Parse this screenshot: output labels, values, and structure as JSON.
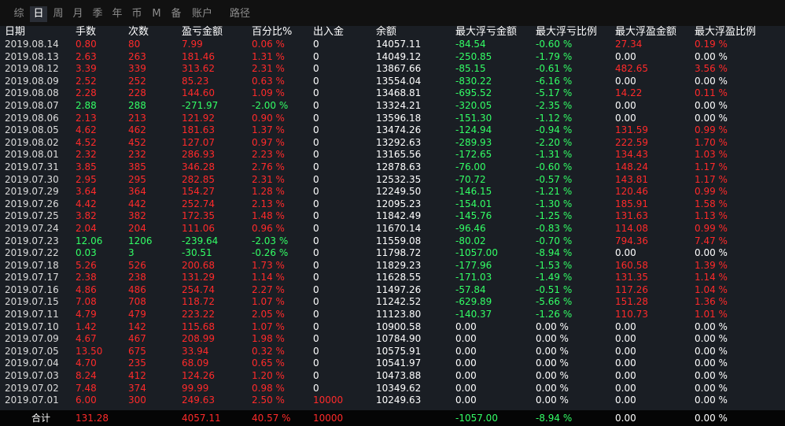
{
  "tabs": [
    "综",
    "日",
    "周",
    "月",
    "季",
    "年",
    "币",
    "M",
    "备",
    "账户",
    "路径"
  ],
  "active_tab": "日",
  "columns": [
    "日期",
    "手数",
    "次数",
    "盈亏金额",
    "百分比%",
    "出入金",
    "余额",
    "最大浮亏金额",
    "最大浮亏比例",
    "最大浮盈金额",
    "最大浮盈比例"
  ],
  "rows": [
    [
      "2019.08.14",
      "0.80",
      "80",
      "7.99",
      "0.06 %",
      "0",
      "14057.11",
      "-84.54",
      "-0.60 %",
      "27.34",
      "0.19 %"
    ],
    [
      "2019.08.13",
      "2.63",
      "263",
      "181.46",
      "1.31 %",
      "0",
      "14049.12",
      "-250.85",
      "-1.79 %",
      "0.00",
      "0.00 %"
    ],
    [
      "2019.08.12",
      "3.39",
      "339",
      "313.62",
      "2.31 %",
      "0",
      "13867.66",
      "-85.15",
      "-0.61 %",
      "482.65",
      "3.56 %"
    ],
    [
      "2019.08.09",
      "2.52",
      "252",
      "85.23",
      "0.63 %",
      "0",
      "13554.04",
      "-830.22",
      "-6.16 %",
      "0.00",
      "0.00 %"
    ],
    [
      "2019.08.08",
      "2.28",
      "228",
      "144.60",
      "1.09 %",
      "0",
      "13468.81",
      "-695.52",
      "-5.17 %",
      "14.22",
      "0.11 %"
    ],
    [
      "2019.08.07",
      "2.88",
      "288",
      "-271.97",
      "-2.00 %",
      "0",
      "13324.21",
      "-320.05",
      "-2.35 %",
      "0.00",
      "0.00 %"
    ],
    [
      "2019.08.06",
      "2.13",
      "213",
      "121.92",
      "0.90 %",
      "0",
      "13596.18",
      "-151.30",
      "-1.12 %",
      "0.00",
      "0.00 %"
    ],
    [
      "2019.08.05",
      "4.62",
      "462",
      "181.63",
      "1.37 %",
      "0",
      "13474.26",
      "-124.94",
      "-0.94 %",
      "131.59",
      "0.99 %"
    ],
    [
      "2019.08.02",
      "4.52",
      "452",
      "127.07",
      "0.97 %",
      "0",
      "13292.63",
      "-289.93",
      "-2.20 %",
      "222.59",
      "1.70 %"
    ],
    [
      "2019.08.01",
      "2.32",
      "232",
      "286.93",
      "2.23 %",
      "0",
      "13165.56",
      "-172.65",
      "-1.31 %",
      "134.43",
      "1.03 %"
    ],
    [
      "2019.07.31",
      "3.85",
      "385",
      "346.28",
      "2.76 %",
      "0",
      "12878.63",
      "-76.00",
      "-0.60 %",
      "148.24",
      "1.17 %"
    ],
    [
      "2019.07.30",
      "2.95",
      "295",
      "282.85",
      "2.31 %",
      "0",
      "12532.35",
      "-70.72",
      "-0.57 %",
      "143.81",
      "1.17 %"
    ],
    [
      "2019.07.29",
      "3.64",
      "364",
      "154.27",
      "1.28 %",
      "0",
      "12249.50",
      "-146.15",
      "-1.21 %",
      "120.46",
      "0.99 %"
    ],
    [
      "2019.07.26",
      "4.42",
      "442",
      "252.74",
      "2.13 %",
      "0",
      "12095.23",
      "-154.01",
      "-1.30 %",
      "185.91",
      "1.58 %"
    ],
    [
      "2019.07.25",
      "3.82",
      "382",
      "172.35",
      "1.48 %",
      "0",
      "11842.49",
      "-145.76",
      "-1.25 %",
      "131.63",
      "1.13 %"
    ],
    [
      "2019.07.24",
      "2.04",
      "204",
      "111.06",
      "0.96 %",
      "0",
      "11670.14",
      "-96.46",
      "-0.83 %",
      "114.08",
      "0.99 %"
    ],
    [
      "2019.07.23",
      "12.06",
      "1206",
      "-239.64",
      "-2.03 %",
      "0",
      "11559.08",
      "-80.02",
      "-0.70 %",
      "794.36",
      "7.47 %"
    ],
    [
      "2019.07.22",
      "0.03",
      "3",
      "-30.51",
      "-0.26 %",
      "0",
      "11798.72",
      "-1057.00",
      "-8.94 %",
      "0.00",
      "0.00 %"
    ],
    [
      "2019.07.18",
      "5.26",
      "526",
      "200.68",
      "1.73 %",
      "0",
      "11829.23",
      "-177.96",
      "-1.53 %",
      "160.58",
      "1.39 %"
    ],
    [
      "2019.07.17",
      "2.38",
      "238",
      "131.29",
      "1.14 %",
      "0",
      "11628.55",
      "-171.03",
      "-1.49 %",
      "131.35",
      "1.14 %"
    ],
    [
      "2019.07.16",
      "4.86",
      "486",
      "254.74",
      "2.27 %",
      "0",
      "11497.26",
      "-57.84",
      "-0.51 %",
      "117.26",
      "1.04 %"
    ],
    [
      "2019.07.15",
      "7.08",
      "708",
      "118.72",
      "1.07 %",
      "0",
      "11242.52",
      "-629.89",
      "-5.66 %",
      "151.28",
      "1.36 %"
    ],
    [
      "2019.07.11",
      "4.79",
      "479",
      "223.22",
      "2.05 %",
      "0",
      "11123.80",
      "-140.37",
      "-1.26 %",
      "110.73",
      "1.01 %"
    ],
    [
      "2019.07.10",
      "1.42",
      "142",
      "115.68",
      "1.07 %",
      "0",
      "10900.58",
      "0.00",
      "0.00 %",
      "0.00",
      "0.00 %"
    ],
    [
      "2019.07.09",
      "4.67",
      "467",
      "208.99",
      "1.98 %",
      "0",
      "10784.90",
      "0.00",
      "0.00 %",
      "0.00",
      "0.00 %"
    ],
    [
      "2019.07.05",
      "13.50",
      "675",
      "33.94",
      "0.32 %",
      "0",
      "10575.91",
      "0.00",
      "0.00 %",
      "0.00",
      "0.00 %"
    ],
    [
      "2019.07.04",
      "4.70",
      "235",
      "68.09",
      "0.65 %",
      "0",
      "10541.97",
      "0.00",
      "0.00 %",
      "0.00",
      "0.00 %"
    ],
    [
      "2019.07.03",
      "8.24",
      "412",
      "124.26",
      "1.20 %",
      "0",
      "10473.88",
      "0.00",
      "0.00 %",
      "0.00",
      "0.00 %"
    ],
    [
      "2019.07.02",
      "7.48",
      "374",
      "99.99",
      "0.98 %",
      "0",
      "10349.62",
      "0.00",
      "0.00 %",
      "0.00",
      "0.00 %"
    ],
    [
      "2019.07.01",
      "6.00",
      "300",
      "249.63",
      "2.50 %",
      "10000",
      "10249.63",
      "0.00",
      "0.00 %",
      "0.00",
      "0.00 %"
    ]
  ],
  "summary": {
    "label": "合计",
    "lots": "131.28",
    "pnl": "4057.11",
    "pct": "40.57 %",
    "deposit": "10000",
    "max_float_loss": "-1057.00",
    "max_float_loss_pct": "-8.94 %",
    "max_float_profit": "0.00",
    "max_float_profit_pct": "0.00 %"
  },
  "colors": {
    "positive": "#ff2a2a",
    "negative": "#33ff66",
    "neutral": "#ffffff",
    "background": "#1a1e24",
    "tabbar": "#111111"
  }
}
